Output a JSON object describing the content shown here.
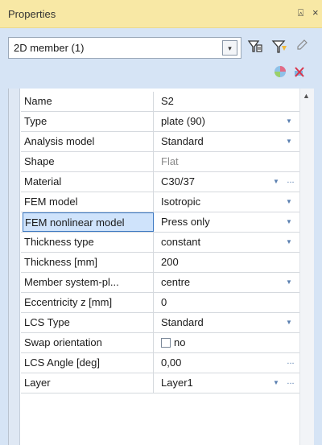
{
  "panel": {
    "title": "Properties",
    "pin_glyph": "⍓",
    "close_glyph": "×"
  },
  "selector": {
    "value": "2D member (1)",
    "dropdown_glyph": "▾"
  },
  "toolbar": {
    "icons": [
      "filter-select-icon",
      "filter-add-icon",
      "edit-pencil-icon"
    ],
    "secondary_icons": [
      "render-sphere-icon",
      "clear-selection-icon"
    ]
  },
  "properties": [
    {
      "name": "Name",
      "value": "S2"
    },
    {
      "name": "Type",
      "value": "plate (90)",
      "dropdown": true
    },
    {
      "name": "Analysis model",
      "value": "Standard",
      "dropdown": true
    },
    {
      "name": "Shape",
      "value": "Flat",
      "readonly": true
    },
    {
      "name": "Material",
      "value": "C30/37",
      "dropdown": true,
      "ellipsis": true
    },
    {
      "name": "FEM model",
      "value": "Isotropic",
      "dropdown": true
    },
    {
      "name": "FEM nonlinear model",
      "value": "Press only",
      "dropdown": true,
      "selected": true
    },
    {
      "name": "Thickness type",
      "value": "constant",
      "dropdown": true
    },
    {
      "name": "Thickness [mm]",
      "value": "200"
    },
    {
      "name": "Member system-pl...",
      "value": "centre",
      "dropdown": true
    },
    {
      "name": "Eccentricity z [mm]",
      "value": "0"
    },
    {
      "name": "LCS Type",
      "value": "Standard",
      "dropdown": true
    },
    {
      "name": "Swap orientation",
      "value": "no",
      "checkbox": true,
      "checked": false
    },
    {
      "name": "LCS Angle [deg]",
      "value": "0,00",
      "ellipsis": true
    },
    {
      "name": "Layer",
      "value": "Layer1",
      "dropdown": true,
      "ellipsis": true
    }
  ],
  "colors": {
    "title_bar": "#f8e8a5",
    "panel_bg": "#d6e4f5",
    "selection": "#cfe3fb",
    "selection_border": "#3b78c2",
    "arrow": "#5a7fb0"
  }
}
